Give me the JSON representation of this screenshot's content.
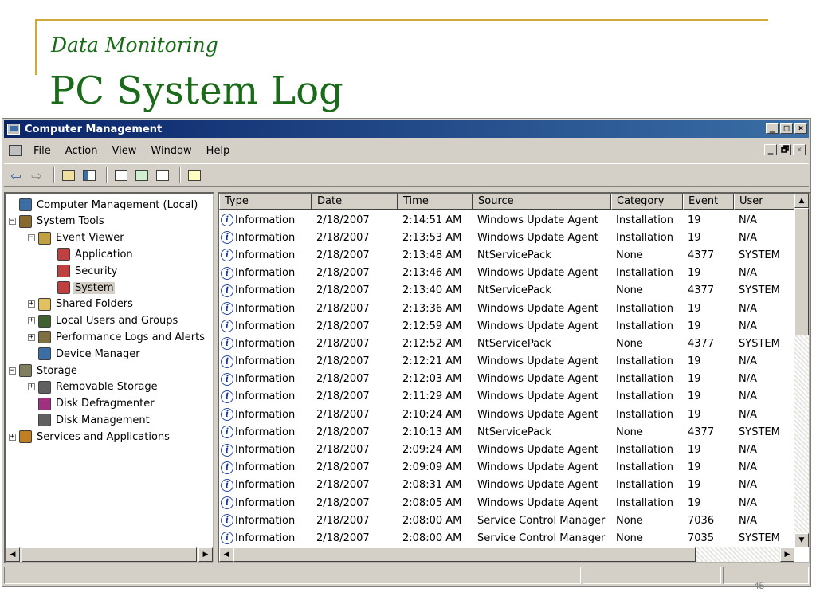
{
  "slide": {
    "subtitle": "Data Monitoring",
    "title": "PC System Log",
    "page_number": "45",
    "accent_color": "#d1a83a",
    "title_color": "#1a6a1a"
  },
  "window": {
    "title": "Computer Management",
    "controls": {
      "minimize": "_",
      "maximize": "□",
      "close": "×"
    },
    "mdi_controls": {
      "minimize": "_",
      "restore": "🗗",
      "close": "×"
    }
  },
  "menu": [
    {
      "label": "File",
      "ul": "F",
      "rest": "ile"
    },
    {
      "label": "Action",
      "ul": "A",
      "rest": "ction"
    },
    {
      "label": "View",
      "ul": "V",
      "rest": "iew"
    },
    {
      "label": "Window",
      "ul": "W",
      "rest": "indow"
    },
    {
      "label": "Help",
      "ul": "H",
      "rest": "elp"
    }
  ],
  "toolbar": {
    "back": "⇦",
    "forward": "⇨",
    "buttons": [
      "up-folder-icon",
      "show-hide-tree-icon",
      "properties-icon",
      "refresh-icon",
      "export-list-icon",
      "help-icon"
    ]
  },
  "tree": [
    {
      "label": "Computer Management (Local)",
      "depth": 0,
      "expander": "",
      "icon": "computer-icon",
      "color": "#3a6ea5"
    },
    {
      "label": "System Tools",
      "depth": 0,
      "expander": "−",
      "icon": "tools-icon",
      "color": "#8a6a2a"
    },
    {
      "label": "Event Viewer",
      "depth": 1,
      "expander": "−",
      "icon": "event-viewer-icon",
      "color": "#c0a040"
    },
    {
      "label": "Application",
      "depth": 2,
      "expander": "",
      "icon": "log-icon",
      "color": "#c04040"
    },
    {
      "label": "Security",
      "depth": 2,
      "expander": "",
      "icon": "log-icon",
      "color": "#c04040"
    },
    {
      "label": "System",
      "depth": 2,
      "expander": "",
      "icon": "log-icon",
      "color": "#c04040",
      "selected": true
    },
    {
      "label": "Shared Folders",
      "depth": 1,
      "expander": "+",
      "icon": "folder-icon",
      "color": "#e0c060"
    },
    {
      "label": "Local Users and Groups",
      "depth": 1,
      "expander": "+",
      "icon": "users-icon",
      "color": "#406030"
    },
    {
      "label": "Performance Logs and Alerts",
      "depth": 1,
      "expander": "+",
      "icon": "performance-icon",
      "color": "#807040"
    },
    {
      "label": "Device Manager",
      "depth": 1,
      "expander": "",
      "icon": "device-manager-icon",
      "color": "#3a6ea5"
    },
    {
      "label": "Storage",
      "depth": 0,
      "expander": "−",
      "icon": "storage-icon",
      "color": "#808060"
    },
    {
      "label": "Removable Storage",
      "depth": 1,
      "expander": "+",
      "icon": "removable-storage-icon",
      "color": "#606060"
    },
    {
      "label": "Disk Defragmenter",
      "depth": 1,
      "expander": "",
      "icon": "defrag-icon",
      "color": "#a03080"
    },
    {
      "label": "Disk Management",
      "depth": 1,
      "expander": "",
      "icon": "disk-icon",
      "color": "#606060"
    },
    {
      "label": "Services and Applications",
      "depth": 0,
      "expander": "+",
      "icon": "services-icon",
      "color": "#c08020"
    }
  ],
  "columns": [
    {
      "label": "Type",
      "key": "type"
    },
    {
      "label": "Date",
      "key": "date"
    },
    {
      "label": "Time",
      "key": "time"
    },
    {
      "label": "Source",
      "key": "source"
    },
    {
      "label": "Category",
      "key": "category"
    },
    {
      "label": "Event",
      "key": "event"
    },
    {
      "label": "User",
      "key": "user"
    }
  ],
  "rows": [
    {
      "type": "Information",
      "date": "2/18/2007",
      "time": "2:14:51 AM",
      "source": "Windows Update Agent",
      "category": "Installation",
      "event": "19",
      "user": "N/A"
    },
    {
      "type": "Information",
      "date": "2/18/2007",
      "time": "2:13:53 AM",
      "source": "Windows Update Agent",
      "category": "Installation",
      "event": "19",
      "user": "N/A"
    },
    {
      "type": "Information",
      "date": "2/18/2007",
      "time": "2:13:48 AM",
      "source": "NtServicePack",
      "category": "None",
      "event": "4377",
      "user": "SYSTEM"
    },
    {
      "type": "Information",
      "date": "2/18/2007",
      "time": "2:13:46 AM",
      "source": "Windows Update Agent",
      "category": "Installation",
      "event": "19",
      "user": "N/A"
    },
    {
      "type": "Information",
      "date": "2/18/2007",
      "time": "2:13:40 AM",
      "source": "NtServicePack",
      "category": "None",
      "event": "4377",
      "user": "SYSTEM"
    },
    {
      "type": "Information",
      "date": "2/18/2007",
      "time": "2:13:36 AM",
      "source": "Windows Update Agent",
      "category": "Installation",
      "event": "19",
      "user": "N/A"
    },
    {
      "type": "Information",
      "date": "2/18/2007",
      "time": "2:12:59 AM",
      "source": "Windows Update Agent",
      "category": "Installation",
      "event": "19",
      "user": "N/A"
    },
    {
      "type": "Information",
      "date": "2/18/2007",
      "time": "2:12:52 AM",
      "source": "NtServicePack",
      "category": "None",
      "event": "4377",
      "user": "SYSTEM"
    },
    {
      "type": "Information",
      "date": "2/18/2007",
      "time": "2:12:21 AM",
      "source": "Windows Update Agent",
      "category": "Installation",
      "event": "19",
      "user": "N/A"
    },
    {
      "type": "Information",
      "date": "2/18/2007",
      "time": "2:12:03 AM",
      "source": "Windows Update Agent",
      "category": "Installation",
      "event": "19",
      "user": "N/A"
    },
    {
      "type": "Information",
      "date": "2/18/2007",
      "time": "2:11:29 AM",
      "source": "Windows Update Agent",
      "category": "Installation",
      "event": "19",
      "user": "N/A"
    },
    {
      "type": "Information",
      "date": "2/18/2007",
      "time": "2:10:24 AM",
      "source": "Windows Update Agent",
      "category": "Installation",
      "event": "19",
      "user": "N/A"
    },
    {
      "type": "Information",
      "date": "2/18/2007",
      "time": "2:10:13 AM",
      "source": "NtServicePack",
      "category": "None",
      "event": "4377",
      "user": "SYSTEM"
    },
    {
      "type": "Information",
      "date": "2/18/2007",
      "time": "2:09:24 AM",
      "source": "Windows Update Agent",
      "category": "Installation",
      "event": "19",
      "user": "N/A"
    },
    {
      "type": "Information",
      "date": "2/18/2007",
      "time": "2:09:09 AM",
      "source": "Windows Update Agent",
      "category": "Installation",
      "event": "19",
      "user": "N/A"
    },
    {
      "type": "Information",
      "date": "2/18/2007",
      "time": "2:08:31 AM",
      "source": "Windows Update Agent",
      "category": "Installation",
      "event": "19",
      "user": "N/A"
    },
    {
      "type": "Information",
      "date": "2/18/2007",
      "time": "2:08:05 AM",
      "source": "Windows Update Agent",
      "category": "Installation",
      "event": "19",
      "user": "N/A"
    },
    {
      "type": "Information",
      "date": "2/18/2007",
      "time": "2:08:00 AM",
      "source": "Service Control Manager",
      "category": "None",
      "event": "7036",
      "user": "N/A"
    },
    {
      "type": "Information",
      "date": "2/18/2007",
      "time": "2:08:00 AM",
      "source": "Service Control Manager",
      "category": "None",
      "event": "7035",
      "user": "SYSTEM"
    }
  ],
  "scroll": {
    "up": "▲",
    "down": "▼",
    "left": "◀",
    "right": "▶"
  }
}
